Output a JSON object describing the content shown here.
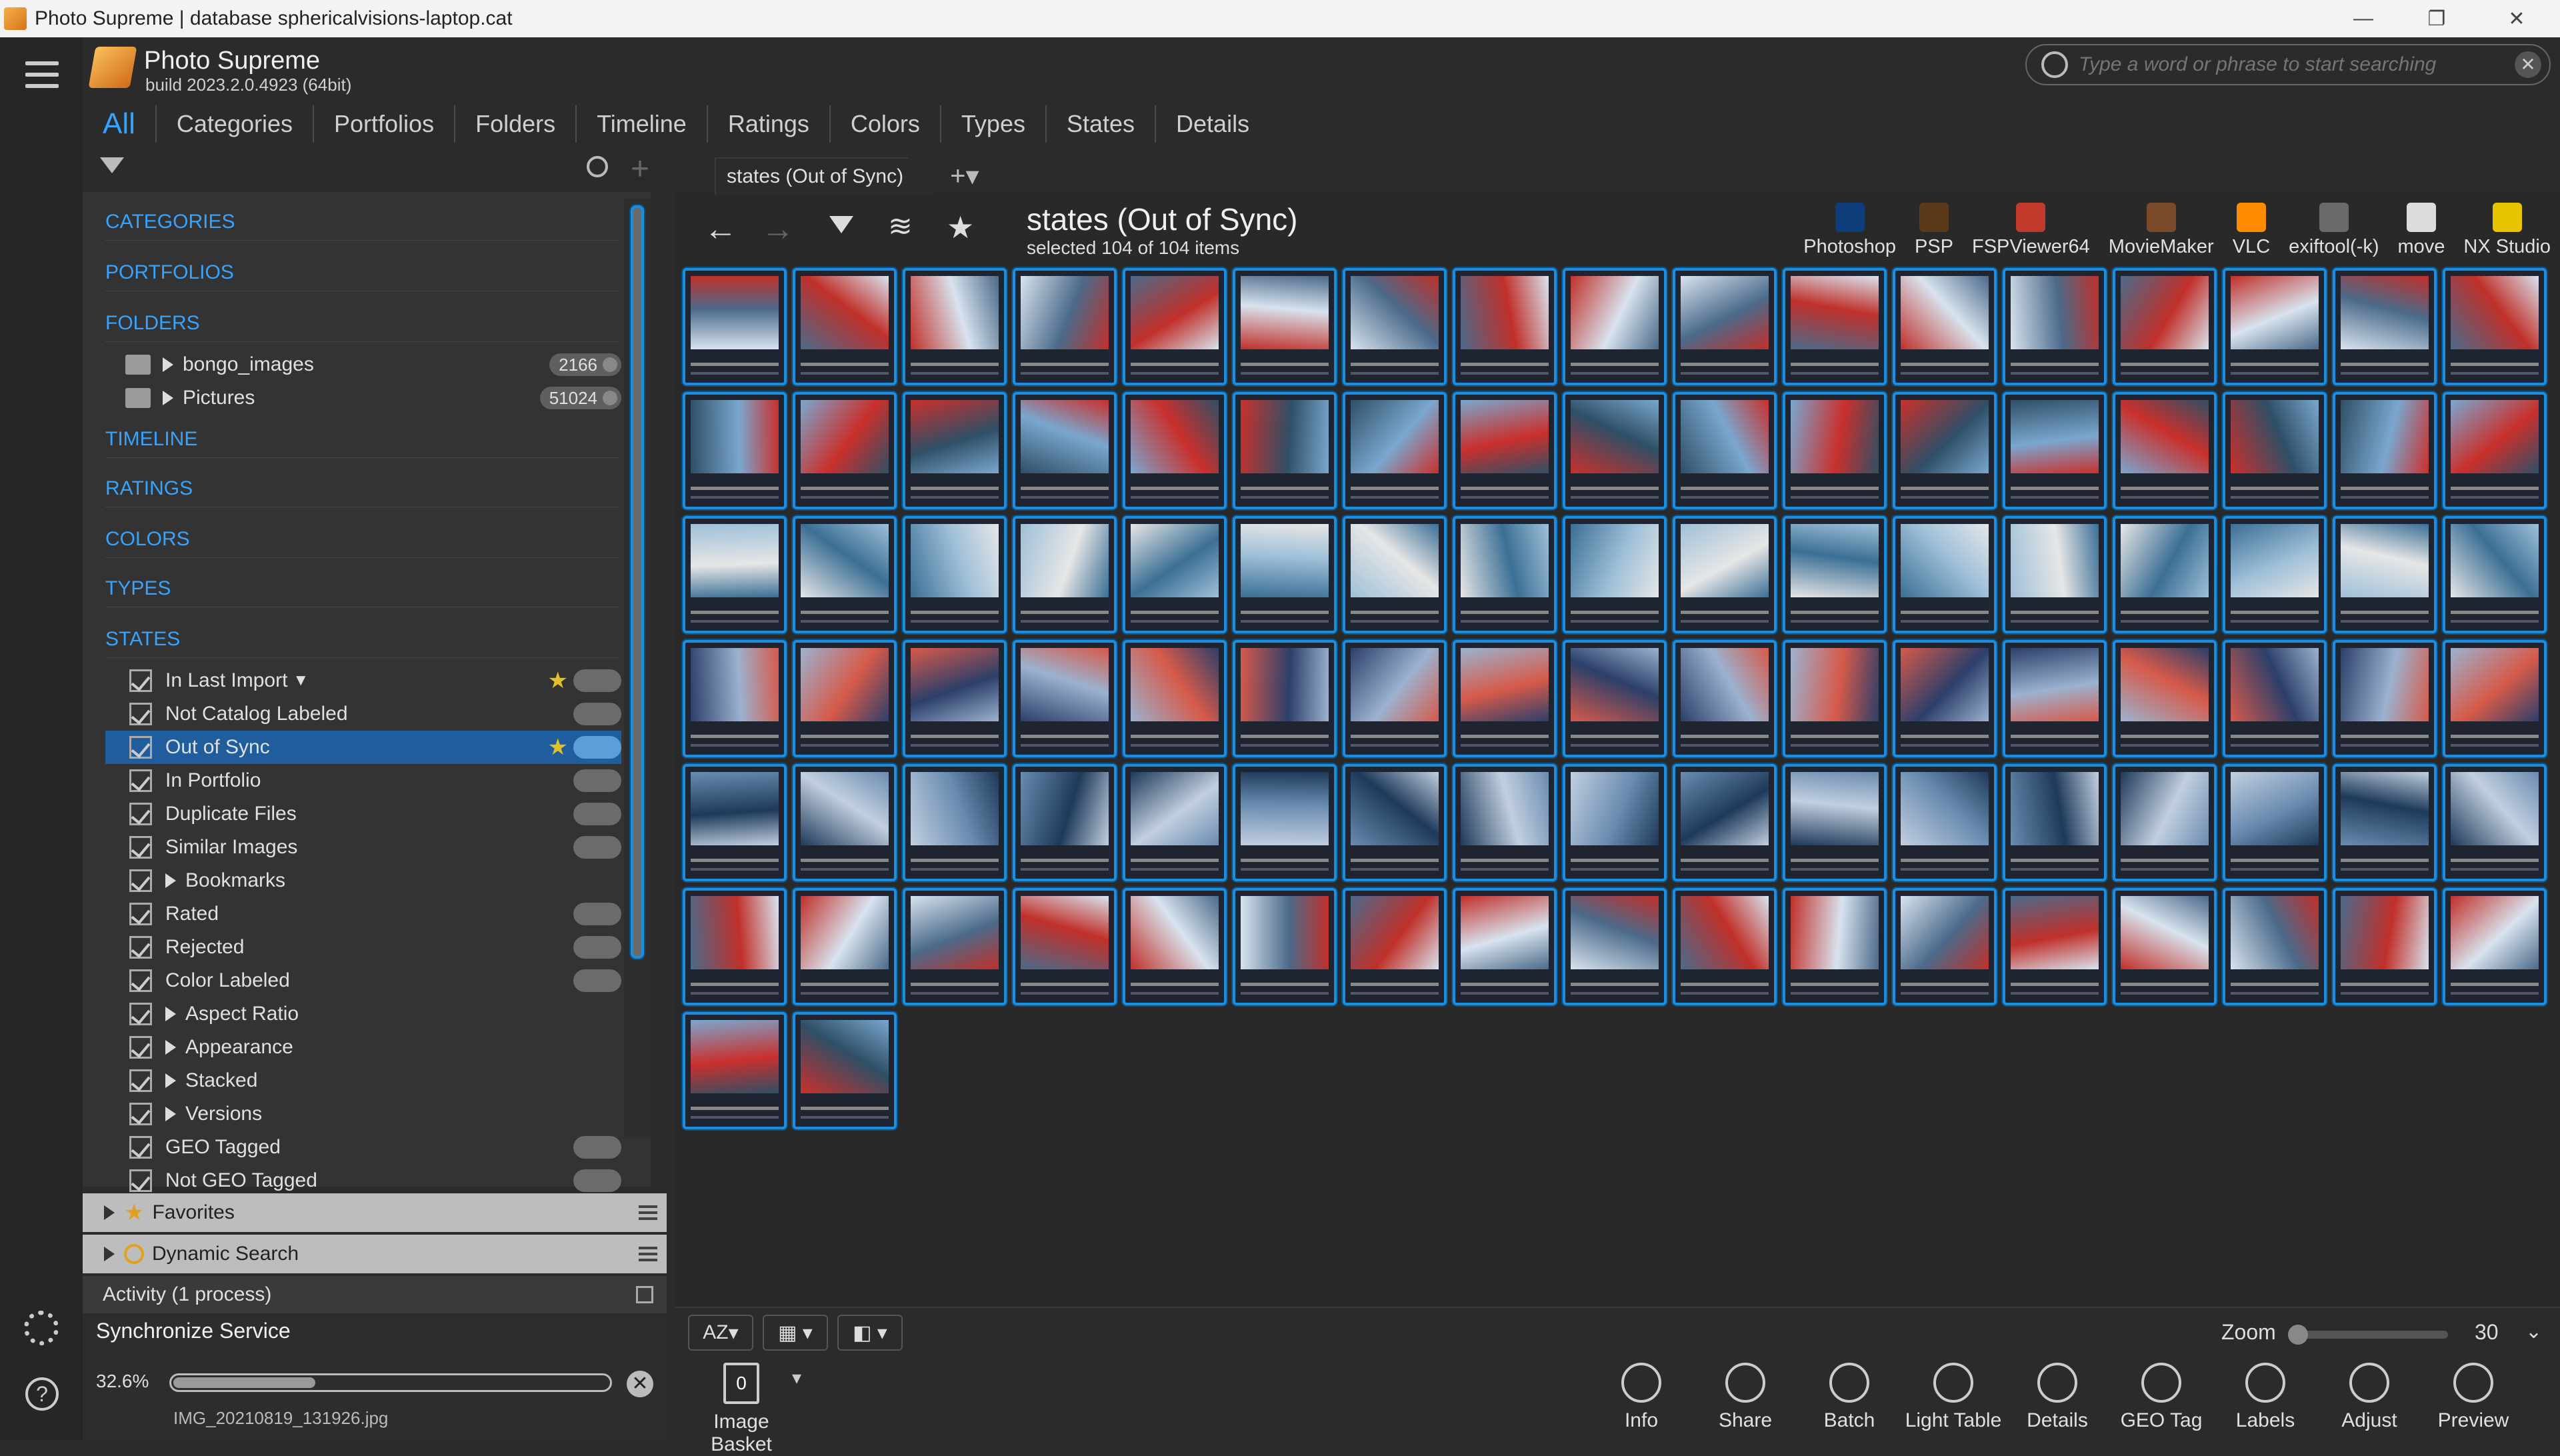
{
  "window": {
    "title": "Photo Supreme | database sphericalvisions-laptop.cat",
    "controls": [
      "—",
      "❐",
      "✕"
    ]
  },
  "app": {
    "name": "Photo Supreme",
    "build": "build 2023.2.0.4923 (64bit)"
  },
  "mainnav": [
    "All",
    "Categories",
    "Portfolios",
    "Folders",
    "Timeline",
    "Ratings",
    "Colors",
    "Types",
    "States",
    "Details"
  ],
  "search": {
    "placeholder": "Type a word or phrase to start searching"
  },
  "sidebar": {
    "sections": {
      "categories": "CATEGORIES",
      "portfolios": "PORTFOLIOS",
      "folders": "FOLDERS",
      "timeline": "TIMELINE",
      "ratings": "RATINGS",
      "colors": "COLORS",
      "types": "TYPES",
      "states": "STATES"
    },
    "folders": [
      {
        "label": "bongo_images",
        "count": "2166"
      },
      {
        "label": "Pictures",
        "count": "51024"
      }
    ],
    "states": [
      "In Last Import",
      "Not Catalog Labeled",
      "Out of Sync",
      "In Portfolio",
      "Duplicate Files",
      "Similar Images",
      "Bookmarks",
      "Rated",
      "Rejected",
      "Color Labeled",
      "Aspect Ratio",
      "Appearance",
      "Stacked",
      "Versions",
      "GEO Tagged",
      "Not GEO Tagged"
    ],
    "selected_state": "Out of Sync"
  },
  "panels": {
    "favorites": "Favorites",
    "dynamic_search": "Dynamic Search"
  },
  "activity": {
    "title": "Activity (1 process)",
    "service": "Synchronize Service",
    "percent_text": "32.6%",
    "progress": 0.326,
    "file": "IMG_20210819_131926.jpg"
  },
  "view": {
    "tab": "states (Out of Sync)",
    "title": "states (Out of Sync)",
    "subtitle": "selected 104 of 104 items",
    "item_count": 104
  },
  "apps": [
    "Photoshop",
    "PSP",
    "FSPViewer64",
    "MovieMaker",
    "VLC",
    "exiftool(-k)",
    "move",
    "NX Studio"
  ],
  "app_colors": [
    "#0d3d7a",
    "#5a3a1a",
    "#c0392b",
    "#7a4a2a",
    "#ff8c00",
    "#6a6a6a",
    "#dddddd",
    "#e8c400"
  ],
  "footer": {
    "sort": "AZ",
    "zoom_label": "Zoom",
    "zoom_value": "30",
    "basket_label": "Image Basket",
    "basket_count": "0",
    "toolbar": [
      "Info",
      "Share",
      "Batch",
      "Light Table",
      "Details",
      "GEO Tag",
      "Labels",
      "Adjust",
      "Preview"
    ]
  },
  "colors": {
    "accent": "#36a3ff",
    "selection": "#1f5d9c",
    "thumb_border": "#1b8ee0",
    "star": "#e2c02a"
  }
}
